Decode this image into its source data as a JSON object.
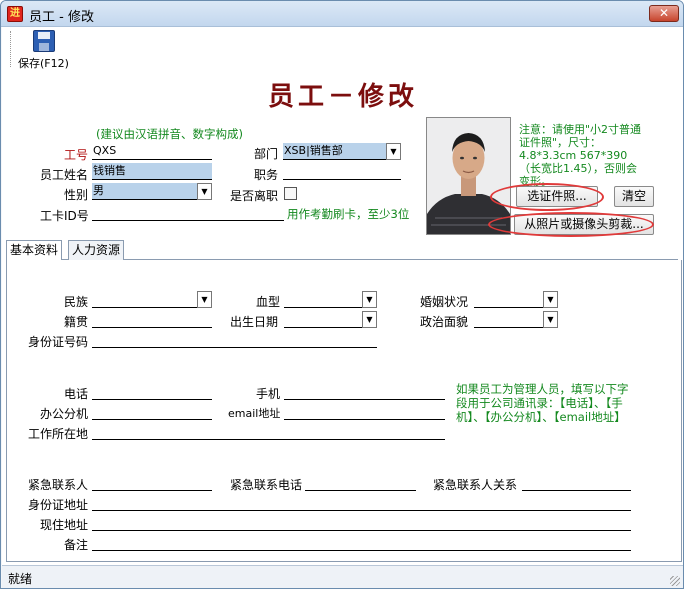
{
  "window": {
    "title": "员工 - 修改",
    "app_icon_glyph": "进",
    "close_glyph": "✕"
  },
  "toolbar": {
    "save_label": "保存(F12)"
  },
  "form": {
    "title": "员工－修改",
    "hint_pinyin": "(建议由汉语拼音、数字构成)",
    "code_label": "工号",
    "code_value": "QXS",
    "name_label": "员工姓名",
    "name_value": "钱销售",
    "gender_label": "性别",
    "gender_value": "男",
    "card_label": "工卡ID号",
    "card_value": "",
    "card_hint": "用作考勤刷卡，至少3位",
    "dept_label": "部门",
    "dept_value": "XSB|销售部",
    "post_label": "职务",
    "post_value": "",
    "resigned_label": "是否离职"
  },
  "photo": {
    "note": "注意：请使用\"小2寸普通证件照\"，尺寸：4.8*3.3cm 567*390 （长宽比1.45），否则会变形。",
    "select_button": "选证件照...",
    "clear_button": "清空",
    "crop_button": "从照片或摄像头剪裁..."
  },
  "tabs": [
    "基本资料",
    "人力资源"
  ],
  "basic": {
    "ethnic_label": "民族",
    "blood_label": "血型",
    "marital_label": "婚姻状况",
    "native_label": "籍贯",
    "birth_label": "出生日期",
    "political_label": "政治面貌",
    "idcard_label": "身份证号码",
    "phone_label": "电话",
    "mobile_label": "手机",
    "ext_label": "办公分机",
    "email_label": "email地址",
    "workplace_label": "工作所在地",
    "manager_note": "如果员工为管理人员，填写以下字段用于公司通讯录：【电话】、【手机】、【办公分机】、【email地址】",
    "emergency_contact_label": "紧急联系人",
    "emergency_phone_label": "紧急联系电话",
    "emergency_relation_label": "紧急联系人关系",
    "id_address_label": "身份证地址",
    "current_address_label": "现住地址",
    "remark_label": "备注"
  },
  "status": {
    "text": "就绪"
  },
  "colors": {
    "title_red": "#7c0e0e",
    "hint_green": "#14891f",
    "highlight": "#b9d2ea",
    "circle_red": "#e03a3a"
  }
}
